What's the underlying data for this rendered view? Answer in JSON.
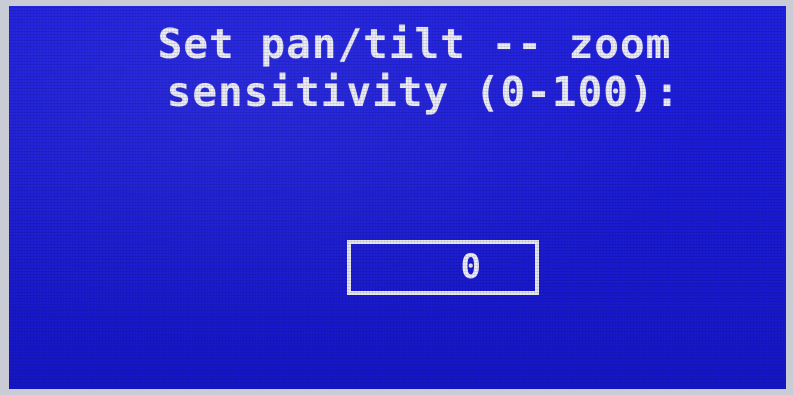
{
  "screen": {
    "prompt_line1": "Set pan/tilt -- zoom",
    "prompt_line2": "sensitivity (0-100):",
    "value": "0",
    "colors": {
      "background": "#1a1ad6",
      "text": "#ececf4",
      "box_border": "#e6e6ee"
    }
  }
}
